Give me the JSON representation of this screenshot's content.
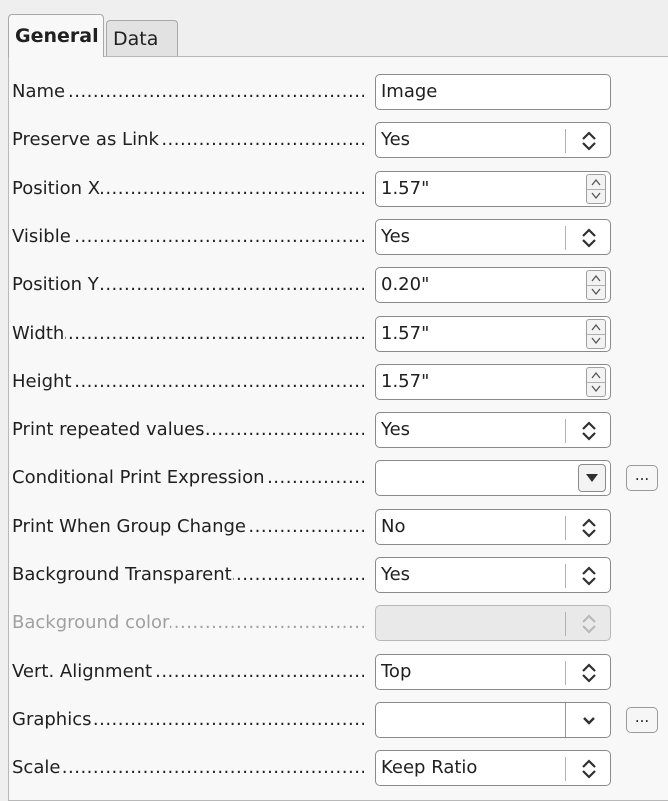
{
  "tabs": [
    {
      "label": "General",
      "active": true
    },
    {
      "label": "Data",
      "active": false
    }
  ],
  "properties": [
    {
      "label": "Name",
      "control": "text",
      "value": "Image"
    },
    {
      "label": "Preserve as Link",
      "control": "listbox",
      "value": "Yes"
    },
    {
      "label": "Position X",
      "control": "numeric",
      "value": "1.57\""
    },
    {
      "label": "Visible",
      "control": "listbox",
      "value": "Yes"
    },
    {
      "label": "Position Y",
      "control": "numeric",
      "value": "0.20\""
    },
    {
      "label": "Width",
      "control": "numeric",
      "value": "1.57\""
    },
    {
      "label": "Height",
      "control": "numeric",
      "value": "1.57\""
    },
    {
      "label": "Print repeated values",
      "control": "listbox",
      "value": "Yes"
    },
    {
      "label": "Conditional Print Expression",
      "control": "combo",
      "value": "",
      "ellipsis": "..."
    },
    {
      "label": "Print When Group Change",
      "control": "listbox",
      "value": "No"
    },
    {
      "label": "Background Transparent",
      "control": "listbox",
      "value": "Yes"
    },
    {
      "label": "Background color",
      "control": "listbox",
      "value": "",
      "disabled": true
    },
    {
      "label": "Vert. Alignment",
      "control": "listbox",
      "value": "Top"
    },
    {
      "label": "Graphics",
      "control": "combo2",
      "value": "",
      "ellipsis": "..."
    },
    {
      "label": "Scale",
      "control": "listbox",
      "value": "Keep Ratio"
    }
  ],
  "icons": {
    "updown": "up-down-arrows-icon",
    "spin": "spin-arrows-icon",
    "dropdown": "dropdown-arrow-icon",
    "chevron": "chevron-down-icon"
  }
}
